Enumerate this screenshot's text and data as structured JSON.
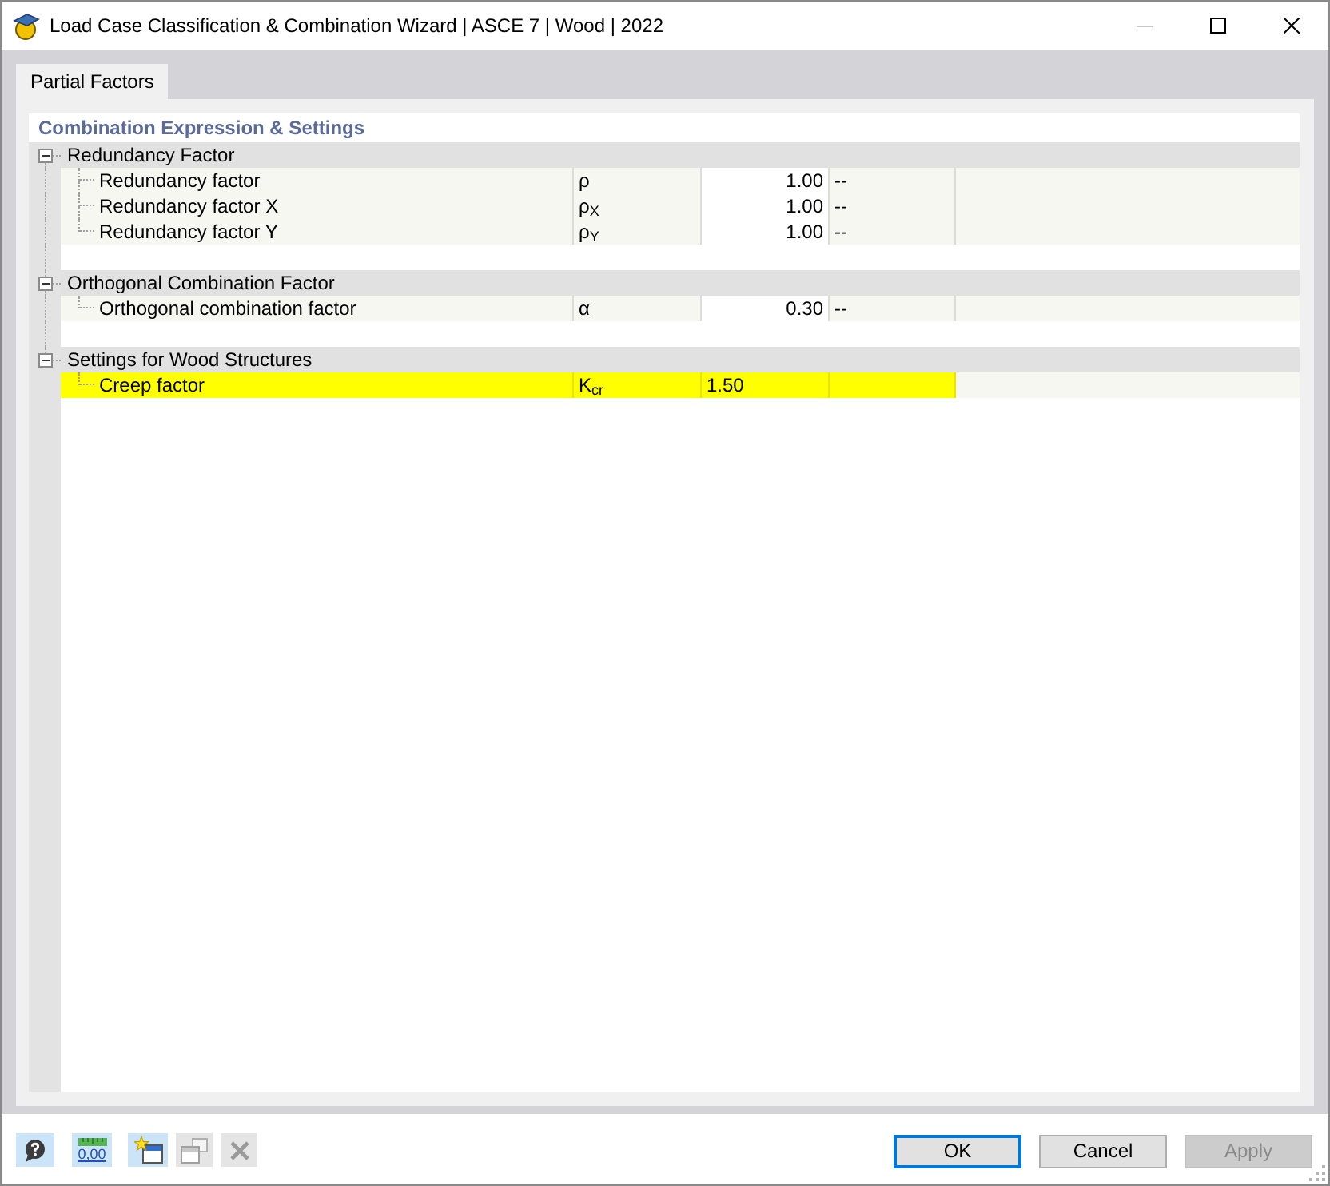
{
  "window": {
    "title": "Load Case Classification & Combination Wizard | ASCE 7 | Wood | 2022",
    "minimize_disabled": true
  },
  "tabs": [
    {
      "label": "Partial Factors",
      "selected": true
    }
  ],
  "panel": {
    "heading": "Combination Expression & Settings",
    "groups": [
      {
        "label": "Redundancy Factor",
        "expanded": true,
        "children": [
          {
            "label": "Redundancy factor",
            "symbol": "ρ",
            "value": "1.00",
            "unit": "--",
            "selected": false
          },
          {
            "label": "Redundancy factor X",
            "symbol": "ρ$_{X}$",
            "value": "1.00",
            "unit": "--",
            "selected": false
          },
          {
            "label": "Redundancy factor Y",
            "symbol": "ρ$_{Y}$",
            "value": "1.00",
            "unit": "--",
            "selected": false
          }
        ]
      },
      {
        "label": "Orthogonal Combination Factor",
        "expanded": true,
        "children": [
          {
            "label": "Orthogonal combination factor",
            "symbol": "α",
            "value": "0.30",
            "unit": "--",
            "selected": false
          }
        ]
      },
      {
        "label": "Settings for Wood Structures",
        "expanded": true,
        "children": [
          {
            "label": "Creep factor",
            "symbol": "K$_{cr}$",
            "value": "1.50",
            "selected": true
          }
        ]
      }
    ]
  },
  "toolbar": [
    {
      "kind": "help",
      "disabled": false
    },
    {
      "kind": "decimals",
      "label": "0,00",
      "disabled": false
    },
    {
      "kind": "new_window",
      "disabled": false
    },
    {
      "kind": "copy_window",
      "disabled": true
    },
    {
      "kind": "delete",
      "disabled": true
    }
  ],
  "buttons": [
    {
      "label": "OK",
      "default": true,
      "disabled": false
    },
    {
      "label": "Cancel",
      "default": false,
      "disabled": false
    },
    {
      "label": "Apply",
      "default": false,
      "disabled": true
    }
  ]
}
